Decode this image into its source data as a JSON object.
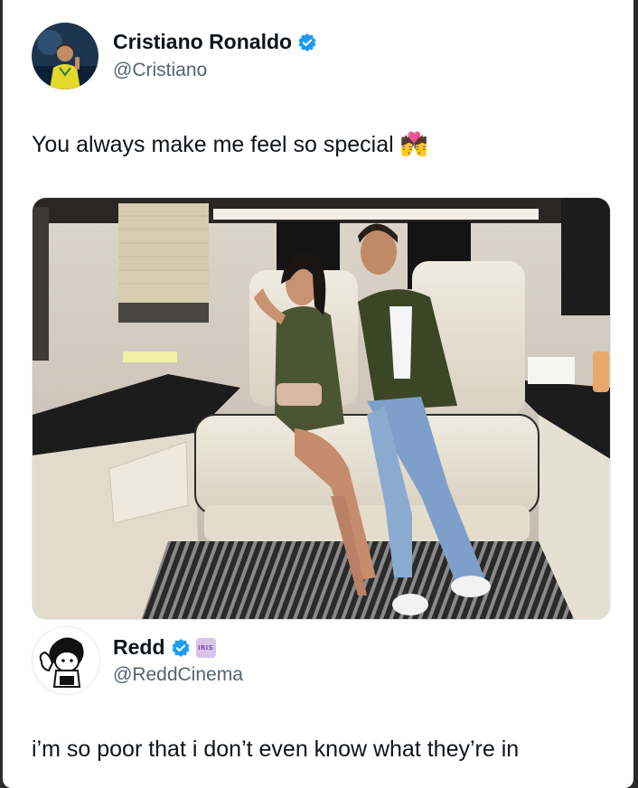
{
  "tweet": {
    "author": {
      "display_name": "Cristiano Ronaldo",
      "handle": "@Cristiano",
      "verified": true
    },
    "text": "You always make me feel so special 💏",
    "media": {
      "icon": "photo",
      "description": ""
    }
  },
  "reply": {
    "author": {
      "display_name": "Redd",
      "handle": "@ReddCinema",
      "verified": true,
      "affiliate_badge": "IRIS"
    },
    "text": "i’m so poor that i don’t even know what they’re in"
  },
  "colors": {
    "verified_blue": "#1d9bf0",
    "text_primary": "#0f1419",
    "text_secondary": "#536471"
  }
}
